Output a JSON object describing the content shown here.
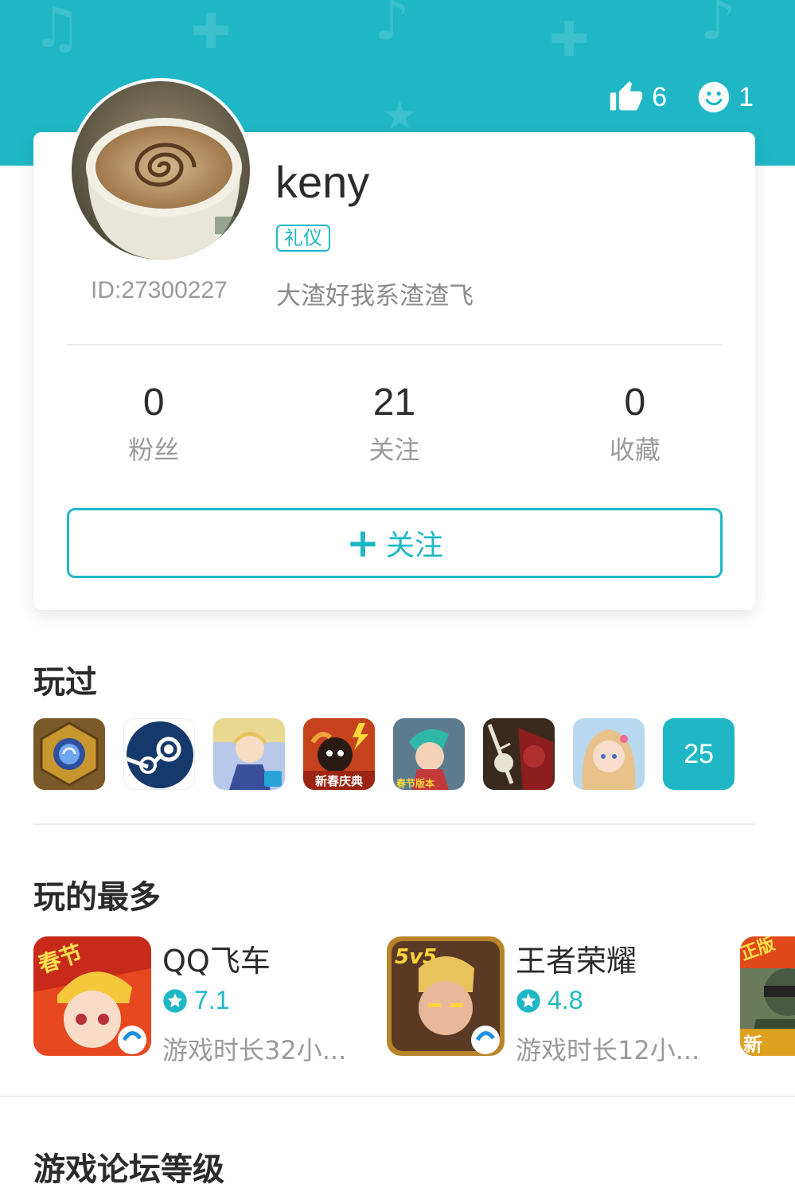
{
  "header": {
    "likes_count": "6",
    "smiles_count": "1",
    "accent_color": "#1fb7c6"
  },
  "profile": {
    "username": "keny",
    "tag": "礼仪",
    "user_id": "ID:27300227",
    "signature": "大渣好我系渣渣飞"
  },
  "counts": [
    {
      "value": "0",
      "label": "粉丝"
    },
    {
      "value": "21",
      "label": "关注"
    },
    {
      "value": "0",
      "label": "收藏"
    }
  ],
  "follow_button": {
    "plus": "+",
    "label": "关注"
  },
  "played": {
    "title": "玩过",
    "games": [
      {
        "name": "hearthstone-icon"
      },
      {
        "name": "steam-icon"
      },
      {
        "name": "fate-grand-order-icon"
      },
      {
        "name": "spring-festival-game-icon",
        "badge": "新春庆典"
      },
      {
        "name": "anime-hero-game-icon",
        "badge": "春节版本"
      },
      {
        "name": "samurai-game-icon"
      },
      {
        "name": "anime-girl-game-icon"
      }
    ],
    "more_count": "25"
  },
  "most_played": {
    "title": "玩的最多",
    "items": [
      {
        "name": "QQ飞车",
        "rating": "7.1",
        "playtime": "游戏时长32小..."
      },
      {
        "name": "王者荣耀",
        "rating": "4.8",
        "playtime": "游戏时长12小..."
      }
    ],
    "icon_badges": [
      "春节",
      "5v5",
      "正版",
      "新"
    ]
  },
  "forum_level": {
    "title": "游戏论坛等级"
  }
}
